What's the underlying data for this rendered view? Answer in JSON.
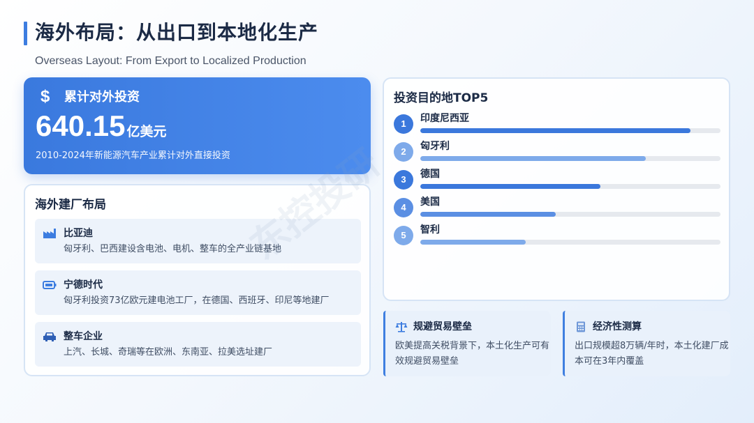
{
  "header": {
    "title": "海外布局：从出口到本地化生产",
    "subtitle": "Overseas Layout: From Export to Localized Production"
  },
  "investment": {
    "icon": "dollar-icon",
    "label": "累计对外投资",
    "amount": "640.15",
    "unit": "亿美元",
    "note": "2010-2024年新能源汽车产业累计对外直接投资"
  },
  "plants": {
    "title": "海外建厂布局",
    "items": [
      {
        "icon": "factory-icon",
        "name": "比亚迪",
        "desc": "匈牙利、巴西建设含电池、电机、整车的全产业链基地"
      },
      {
        "icon": "battery-icon",
        "name": "宁德时代",
        "desc": "匈牙利投资73亿欧元建电池工厂，在德国、西班牙、印尼等地建厂"
      },
      {
        "icon": "car-icon",
        "name": "整车企业",
        "desc": "上汽、长城、奇瑞等在欧洲、东南亚、拉美选址建厂"
      }
    ]
  },
  "top5": {
    "title": "投资目的地TOP5",
    "items": [
      {
        "rank": "1",
        "name": "印度尼西亚",
        "level": 0.9,
        "color": "#3b78dc"
      },
      {
        "rank": "2",
        "name": "匈牙利",
        "level": 0.75,
        "color": "#7eaaea"
      },
      {
        "rank": "3",
        "name": "德国",
        "level": 0.6,
        "color": "#3b78dc"
      },
      {
        "rank": "4",
        "name": "美国",
        "level": 0.45,
        "color": "#5b8fe3"
      },
      {
        "rank": "5",
        "name": "智利",
        "level": 0.35,
        "color": "#7eaaea"
      }
    ]
  },
  "cards": [
    {
      "icon": "scale-icon",
      "title": "规避贸易壁垒",
      "body": "欧美提高关税背景下，本土化生产可有效规避贸易壁垒"
    },
    {
      "icon": "calculator-icon",
      "title": "经济性测算",
      "body": "出口规模超8万辆/年时，本土化建厂成本可在3年内覆盖"
    }
  ],
  "watermark": "东控投研",
  "colors": {
    "accent": "#3d7de0",
    "card_bg": "#edf3fb"
  }
}
